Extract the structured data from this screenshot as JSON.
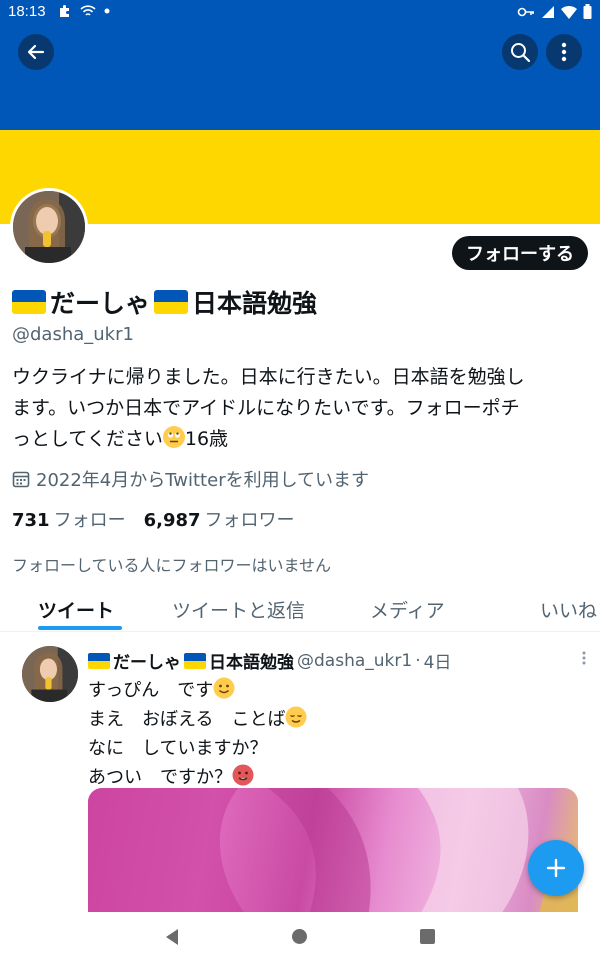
{
  "status_bar": {
    "time": "18:13"
  },
  "profile": {
    "follow_button": "フォローする",
    "name_text": "だーしゃ",
    "name_suffix": "日本語勉強",
    "handle": "@dasha_ukr1",
    "bio_line1": "ウクライナに帰りました。日本に行きたい。日本語を勉強し",
    "bio_line2": "ます。いつか日本でアイドルになりたいです。フォローポチ",
    "bio_line3_a": "っとしてください",
    "bio_line3_b": "16歳",
    "joined": "2022年4月からTwitterを利用しています",
    "following_count": "731",
    "following_label": "フォロー",
    "followers_count": "6,987",
    "followers_label": "フォロワー",
    "mutual_note": "フォローしている人にフォロワーはいません"
  },
  "tabs": [
    {
      "label": "ツイート",
      "active": true
    },
    {
      "label": "ツイートと返信",
      "active": false
    },
    {
      "label": "メディア",
      "active": false
    },
    {
      "label": "いいね",
      "active": false
    }
  ],
  "tweet": {
    "name_text": "だーしゃ",
    "name_suffix": "日本語勉強",
    "handle": "@dasha_ukr1",
    "separator": "·",
    "time": "4日",
    "line1": "すっぴん　です",
    "line2": "まえ　おぼえる　ことば",
    "line3": "なに　していますか？",
    "line4": "あつい　ですか？"
  },
  "colors": {
    "flag_blue": "#0057b7",
    "flag_yellow": "#ffd700",
    "accent": "#1d9bf0"
  },
  "icons": [
    "back-arrow-icon",
    "search-icon",
    "more-vertical-icon",
    "calendar-icon",
    "plus-icon"
  ]
}
